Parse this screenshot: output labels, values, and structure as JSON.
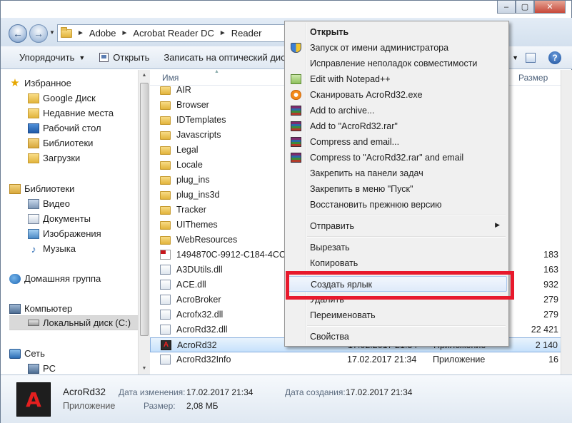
{
  "address": {
    "crumbs": [
      "Adobe",
      "Acrobat Reader DC",
      "Reader"
    ]
  },
  "caption": {
    "minimize": "–",
    "maximize": "▢",
    "close": "✕"
  },
  "toolbar": {
    "organize": "Упорядочить",
    "open": "Открыть",
    "burn": "Записать на оптический диск"
  },
  "nav": {
    "favorites": "Избранное",
    "google_drive": "Google Диск",
    "recent": "Недавние места",
    "desktop": "Рабочий стол",
    "libraries_fav": "Библиотеки",
    "downloads": "Загрузки",
    "libraries": "Библиотеки",
    "video": "Видео",
    "documents": "Документы",
    "images": "Изображения",
    "music": "Музыка",
    "homegroup": "Домашняя группа",
    "computer": "Компьютер",
    "local_disk": "Локальный диск (C:)",
    "network": "Сеть",
    "pc": "PC"
  },
  "columns": {
    "name": "Имя",
    "size": "Размер"
  },
  "files": [
    {
      "name": "AIR",
      "icon": "folder-icon"
    },
    {
      "name": "Browser",
      "icon": "folder-icon"
    },
    {
      "name": "IDTemplates",
      "icon": "folder-icon"
    },
    {
      "name": "Javascripts",
      "icon": "folder-icon"
    },
    {
      "name": "Legal",
      "icon": "folder-icon"
    },
    {
      "name": "Locale",
      "icon": "folder-icon"
    },
    {
      "name": "plug_ins",
      "icon": "folder-icon"
    },
    {
      "name": "plug_ins3d",
      "icon": "folder-icon"
    },
    {
      "name": "Tracker",
      "icon": "folder-icon"
    },
    {
      "name": "UIThemes",
      "icon": "folder-icon"
    },
    {
      "name": "WebResources",
      "icon": "folder-icon"
    },
    {
      "name": "1494870C-9912-C184-4CC9-B",
      "icon": "pdf-file-icon",
      "size": "183"
    },
    {
      "name": "A3DUtils.dll",
      "icon": "dll-file-icon",
      "size": "163"
    },
    {
      "name": "ACE.dll",
      "icon": "dll-file-icon",
      "size": "932"
    },
    {
      "name": "AcroBroker",
      "icon": "exe-file-icon",
      "size": "279"
    },
    {
      "name": "Acrofx32.dll",
      "icon": "dll-file-icon",
      "size": "279"
    },
    {
      "name": "AcroRd32.dll",
      "icon": "dll-file-icon",
      "size": "22 421"
    },
    {
      "name": "AcroRd32",
      "icon": "acrobat-icon",
      "date": "17.02.2017 21:34",
      "type": "Приложение",
      "size": "2 140"
    },
    {
      "name": "AcroRd32Info",
      "icon": "dll-file-icon",
      "date": "17.02.2017 21:34",
      "type": "Приложение",
      "size": "16"
    }
  ],
  "context_menu": {
    "open": "Открыть",
    "run_as_admin": "Запуск от имени администратора",
    "compat": "Исправление неполадок совместимости",
    "notepad": "Edit with Notepad++",
    "scan": "Сканировать AcroRd32.exe",
    "add_archive": "Add to archive...",
    "add_rar": "Add to \"AcroRd32.rar\"",
    "compress_email": "Compress and email...",
    "compress_rar_email": "Compress to \"AcroRd32.rar\" and email",
    "pin_taskbar": "Закрепить на панели задач",
    "pin_start": "Закрепить в меню \"Пуск\"",
    "restore": "Восстановить прежнюю версию",
    "send_to": "Отправить",
    "cut": "Вырезать",
    "copy": "Копировать",
    "create_shortcut": "Создать ярлык",
    "delete": "Удалить",
    "rename": "Переименовать",
    "properties": "Свойства"
  },
  "details": {
    "name": "AcroRd32",
    "type": "Приложение",
    "modified_label": "Дата изменения:",
    "modified_value": "17.02.2017 21:34",
    "size_label": "Размер:",
    "size_value": "2,08 МБ",
    "created_label": "Дата создания:",
    "created_value": "17.02.2017 21:34"
  },
  "colors": {
    "highlight_box": "#e8192c",
    "selection": "#c6e1fb"
  }
}
